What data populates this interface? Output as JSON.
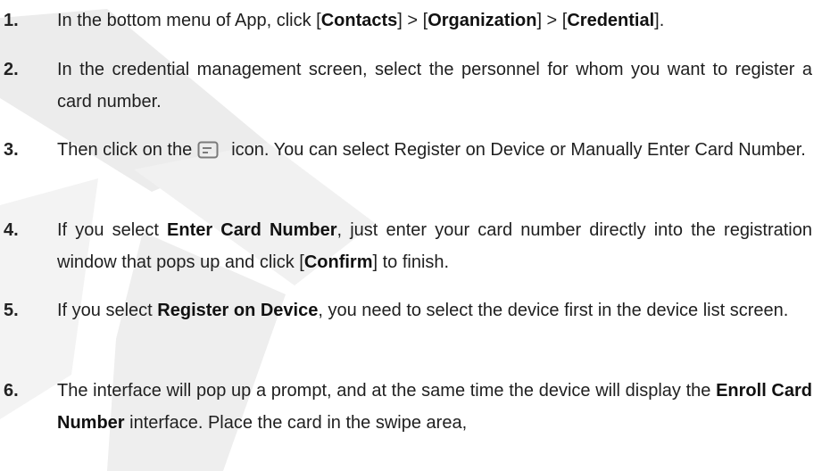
{
  "steps": [
    {
      "number": "1.",
      "parts": [
        {
          "t": "In the bottom menu of App, click ["
        },
        {
          "b": "Contacts"
        },
        {
          "t": "] > ["
        },
        {
          "b": "Organization"
        },
        {
          "t": "] > ["
        },
        {
          "b": "Credential"
        },
        {
          "t": "]."
        }
      ]
    },
    {
      "number": "2.",
      "parts": [
        {
          "t": "In the credential management screen, select the personnel for whom you want to register a card number."
        }
      ]
    },
    {
      "number": "3.",
      "parts": [
        {
          "t": "Then click on the"
        },
        {
          "icon": "card-icon"
        },
        {
          "t": "icon. You can select Register on Device or Manually Enter Card Number."
        }
      ]
    },
    {
      "number": "4.",
      "parts": [
        {
          "t": "If you select "
        },
        {
          "b": "Enter Card Number"
        },
        {
          "t": ", just enter your card number directly into the registration window that pops up and click ["
        },
        {
          "b": "Confirm"
        },
        {
          "t": "] to finish."
        }
      ]
    },
    {
      "number": "5.",
      "parts": [
        {
          "t": "If you select "
        },
        {
          "b": "Register on Device"
        },
        {
          "t": ", you need to select the device first in the device list screen."
        }
      ]
    },
    {
      "number": "6.",
      "parts": [
        {
          "t": "The interface will pop up a prompt, and at the same time the device will display the "
        },
        {
          "b": "Enroll Card Number"
        },
        {
          "t": " interface. Place the card in the swipe area,"
        }
      ]
    }
  ],
  "colors": {
    "text": "#1f1f1f",
    "watermark": "#e6e6e6",
    "icon": "#7a7a7a"
  }
}
